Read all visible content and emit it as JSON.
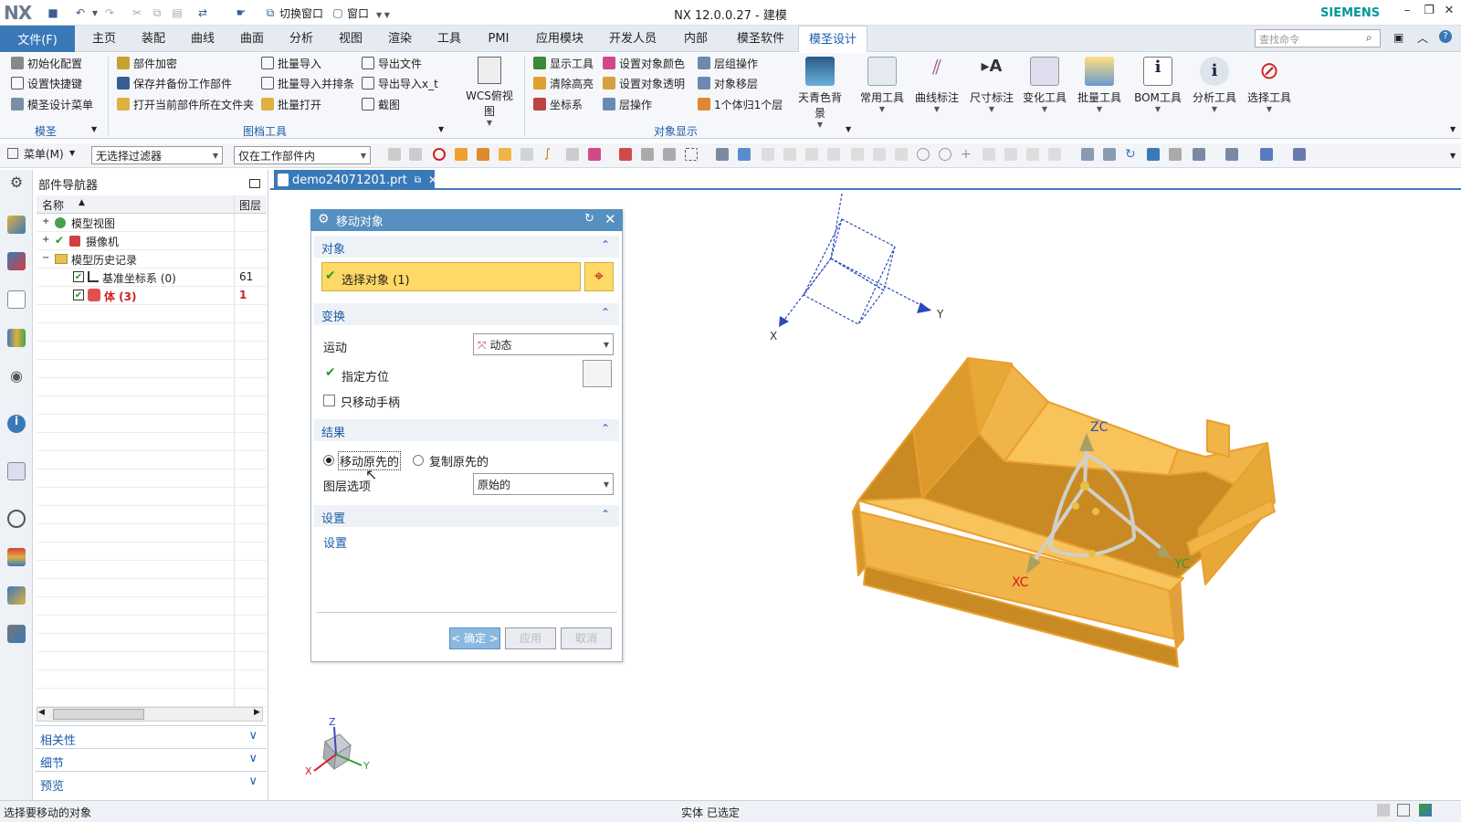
{
  "app": {
    "logo": "NX",
    "title": "NX 12.0.0.27 - 建模",
    "brand": "SIEMENS"
  },
  "quick_access": {
    "switch_window": "切换窗口",
    "window": "窗口"
  },
  "menu": {
    "file": "文件(F)",
    "items": [
      "主页",
      "装配",
      "曲线",
      "曲面",
      "分析",
      "视图",
      "渲染",
      "工具",
      "PMI",
      "应用模块",
      "开发人员",
      "内部",
      "模圣软件",
      "模圣设计"
    ],
    "active": "模圣设计",
    "search_placeholder": "查找命令"
  },
  "ribbon": {
    "group_mosheng": {
      "label": "模圣",
      "items": [
        "初始化配置",
        "设置快捷键",
        "模圣设计菜单"
      ]
    },
    "group_doc": {
      "label": "图档工具",
      "col1": [
        "部件加密",
        "保存并备份工作部件",
        "打开当前部件所在文件夹"
      ],
      "col2": [
        "批量导入",
        "批量导入并排条",
        "批量打开"
      ],
      "col3": [
        "导出文件",
        "导出导入x_t",
        "截图"
      ]
    },
    "wcs_view": "WCS俯视图",
    "group_display": {
      "label": "对象显示",
      "col1": [
        "显示工具",
        "清除高亮",
        "坐标系"
      ],
      "col2": [
        "设置对象颜色",
        "设置对象透明",
        "层操作"
      ],
      "col3": [
        "层组操作",
        "对象移层",
        "1个体归1个层"
      ]
    },
    "big_buttons": [
      "天青色背景",
      "常用工具",
      "曲线标注",
      "尺寸标注",
      "变化工具",
      "批量工具",
      "BOM工具",
      "分析工具",
      "选择工具"
    ]
  },
  "filterbar": {
    "menu": "菜单(M)",
    "filter": "无选择过滤器",
    "scope": "仅在工作部件内"
  },
  "navigator": {
    "title": "部件导航器",
    "col_name": "名称",
    "col_layer": "图层",
    "rows": [
      {
        "label": "模型视图",
        "layer": ""
      },
      {
        "label": "摄像机",
        "layer": ""
      },
      {
        "label": "模型历史记录",
        "layer": ""
      },
      {
        "label": "基准坐标系 (0)",
        "layer": "61"
      },
      {
        "label": "体 (3)",
        "layer": "1"
      }
    ],
    "sections": [
      "相关性",
      "细节",
      "预览"
    ]
  },
  "document_tab": "demo24071201.prt",
  "dialog": {
    "title": "移动对象",
    "sect_object": "对象",
    "select_object": "选择对象 (1)",
    "sect_transform": "变换",
    "motion_label": "运动",
    "motion_value": "动态",
    "specify_orient": "指定方位",
    "move_handle_only": "只移动手柄",
    "sect_result": "结果",
    "radio_move": "移动原先的",
    "radio_copy": "复制原先的",
    "layer_option_label": "图层选项",
    "layer_option_value": "原始的",
    "sect_settings": "设置",
    "settings_body": "设置",
    "btn_ok": "< 确定 >",
    "btn_apply": "应用",
    "btn_cancel": "取消"
  },
  "viewport": {
    "zc": "ZC",
    "yc": "YC",
    "xc": "XC",
    "x": "X",
    "y": "Y",
    "z": "Z"
  },
  "status": {
    "left": "选择要移动的对象",
    "mid": "实体 已选定"
  },
  "colors": {
    "accent": "#3a79b8",
    "part": "#f0b448",
    "part_dark": "#c98a24",
    "highlight": "#ffd966",
    "dialog_title": "#5590c0"
  }
}
